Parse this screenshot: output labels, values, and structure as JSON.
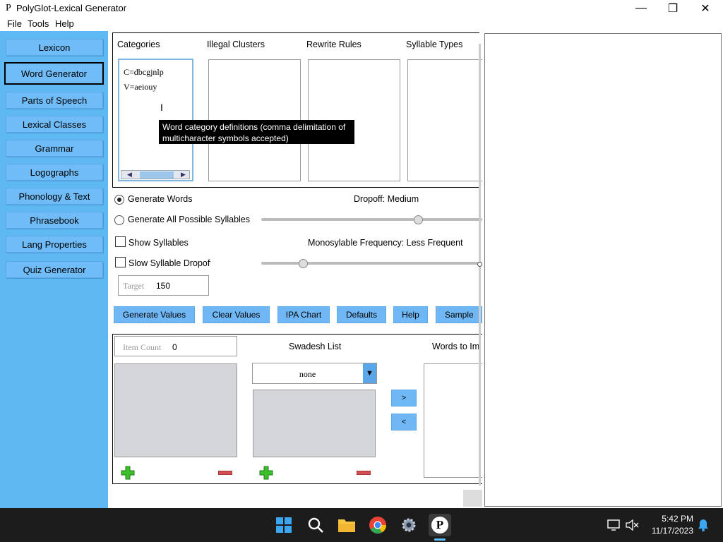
{
  "window": {
    "app_icon": "P",
    "title": "PolyGlot-Lexical Generator",
    "minimize": "—",
    "maximize": "❐",
    "close": "✕"
  },
  "menu": [
    "File",
    "Tools",
    "Help"
  ],
  "sidebar": {
    "items": [
      {
        "label": "Lexicon"
      },
      {
        "label": "Word Generator"
      },
      {
        "label": "Parts of Speech"
      },
      {
        "label": "Lexical Classes"
      },
      {
        "label": "Grammar"
      },
      {
        "label": "Logographs"
      },
      {
        "label": "Phonology & Text"
      },
      {
        "label": "Phrasebook"
      },
      {
        "label": "Lang Properties"
      },
      {
        "label": "Quiz Generator"
      }
    ],
    "active": "Word Generator"
  },
  "columns": {
    "categories": "Categories",
    "illegal_clusters": "Illegal Clusters",
    "rewrite_rules": "Rewrite Rules",
    "syllable_types": "Syllable Types"
  },
  "categories_text": {
    "line1": "C=dbcgjnlp",
    "line2": "V=aeiouy"
  },
  "tooltip": {
    "line1": "Word category definitions (comma delimitation of",
    "line2": "multicharacter symbols accepted)"
  },
  "options": {
    "generate_words": "Generate Words",
    "generate_all": "Generate All Possible Syllables",
    "show_syllables": "Show Syllables",
    "slow_dropoff": "Slow Syllable Dropoff",
    "dropoff_label": "Dropoff: Medium",
    "mono_label": "Monosylable Frequency: Less Frequent",
    "dropoff_level": 0.75,
    "mono_level": 0.2
  },
  "target": {
    "label": "Target",
    "value": "150"
  },
  "buttons": {
    "generate": "Generate Values",
    "clear": "Clear Values",
    "ipa": "IPA Chart",
    "defaults": "Defaults",
    "help": "Help",
    "sample": "Sample"
  },
  "bottom": {
    "item_count_label": "Item Count",
    "item_count_value": "0",
    "swadesh_label": "Swadesh List",
    "swadesh_selected": "none",
    "words_to_import": "Words to Im",
    "move_right": ">",
    "move_left": "<"
  },
  "taskbar": {
    "time": "5:42 PM",
    "date": "11/17/2023"
  }
}
